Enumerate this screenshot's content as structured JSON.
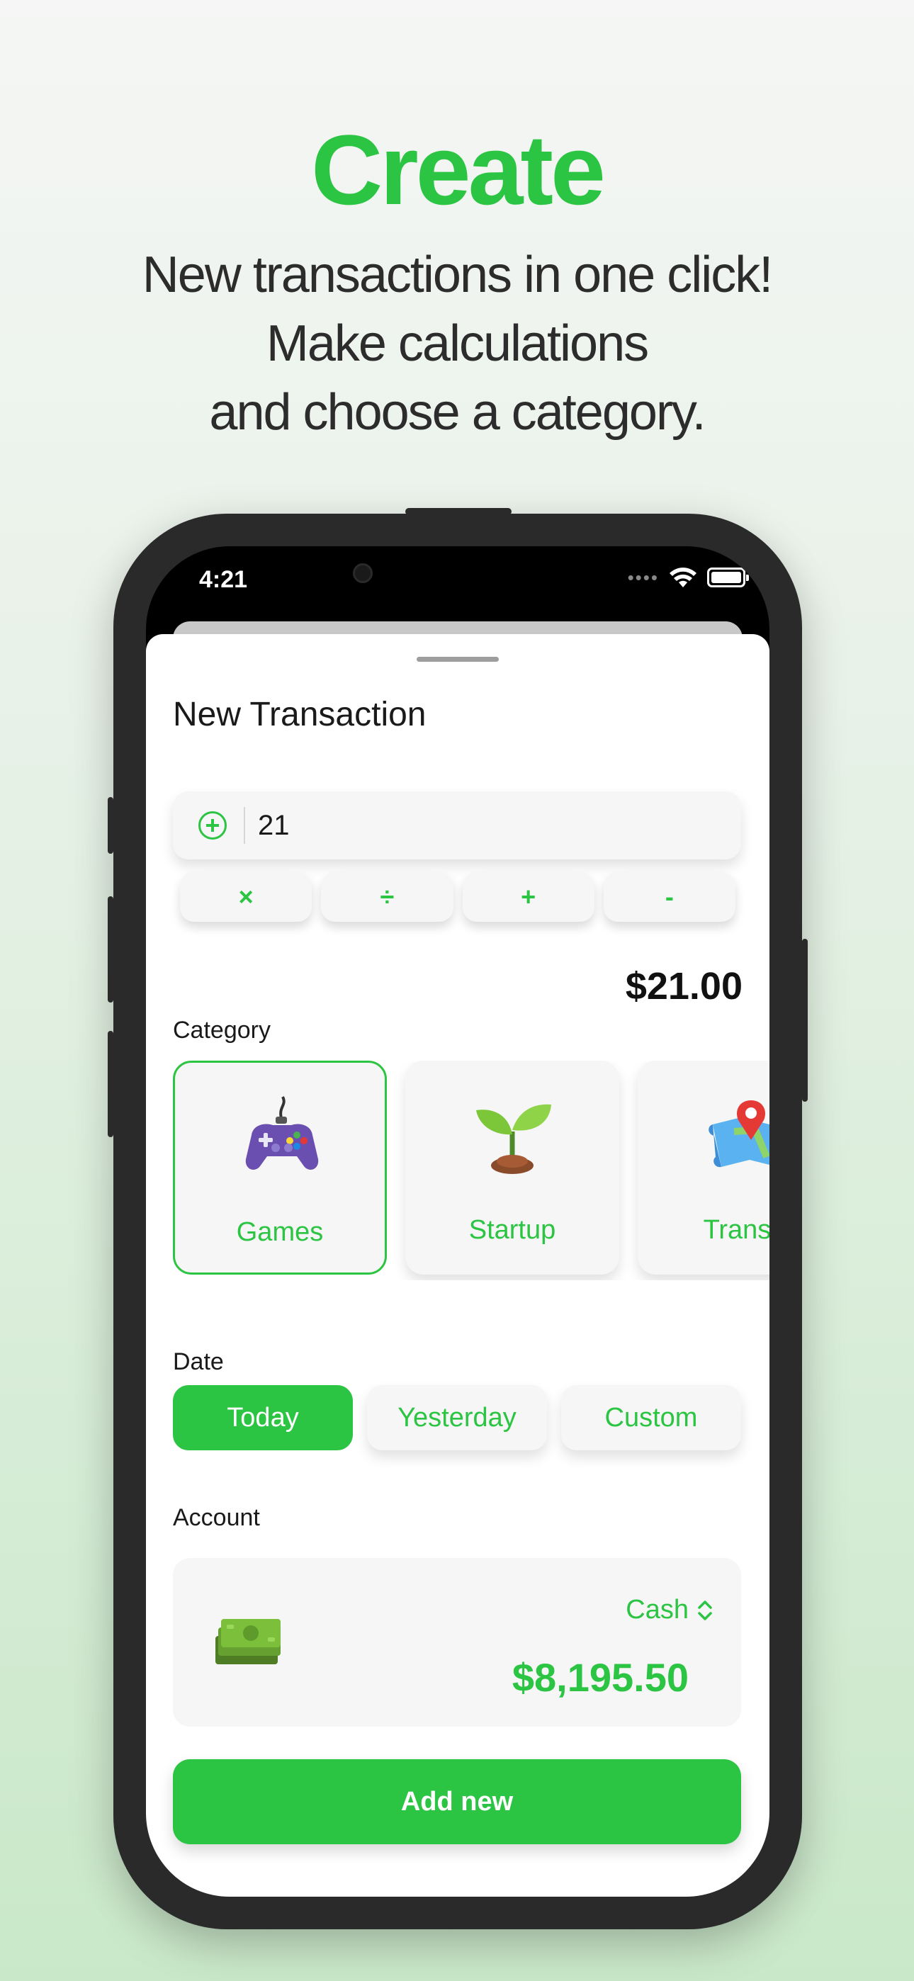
{
  "promo": {
    "headline": "Create",
    "lines": [
      "New transactions in one click!",
      "Make calculations",
      "and choose a category."
    ]
  },
  "status_bar": {
    "time": "4:21"
  },
  "sheet": {
    "title": "New Transaction",
    "amount_input": {
      "value": "21"
    },
    "operators": [
      "×",
      "÷",
      "+",
      "-"
    ],
    "total": "$21.00",
    "category_label": "Category",
    "categories": [
      {
        "label": "Games",
        "icon": "gamepad-icon",
        "selected": true
      },
      {
        "label": "Startup",
        "icon": "sprout-icon",
        "selected": false
      },
      {
        "label": "Transp",
        "icon": "map-pin-icon",
        "selected": false
      }
    ],
    "date_label": "Date",
    "dates": [
      {
        "label": "Today",
        "active": true
      },
      {
        "label": "Yesterday",
        "active": false
      },
      {
        "label": "Custom",
        "active": false
      }
    ],
    "account_label": "Account",
    "account": {
      "name": "Cash",
      "balance": "$8,195.50",
      "icon": "money-stack-icon"
    },
    "add_button": "Add new"
  },
  "colors": {
    "accent": "#2cc443",
    "text": "#1a1a1a",
    "card": "#f6f6f6"
  }
}
